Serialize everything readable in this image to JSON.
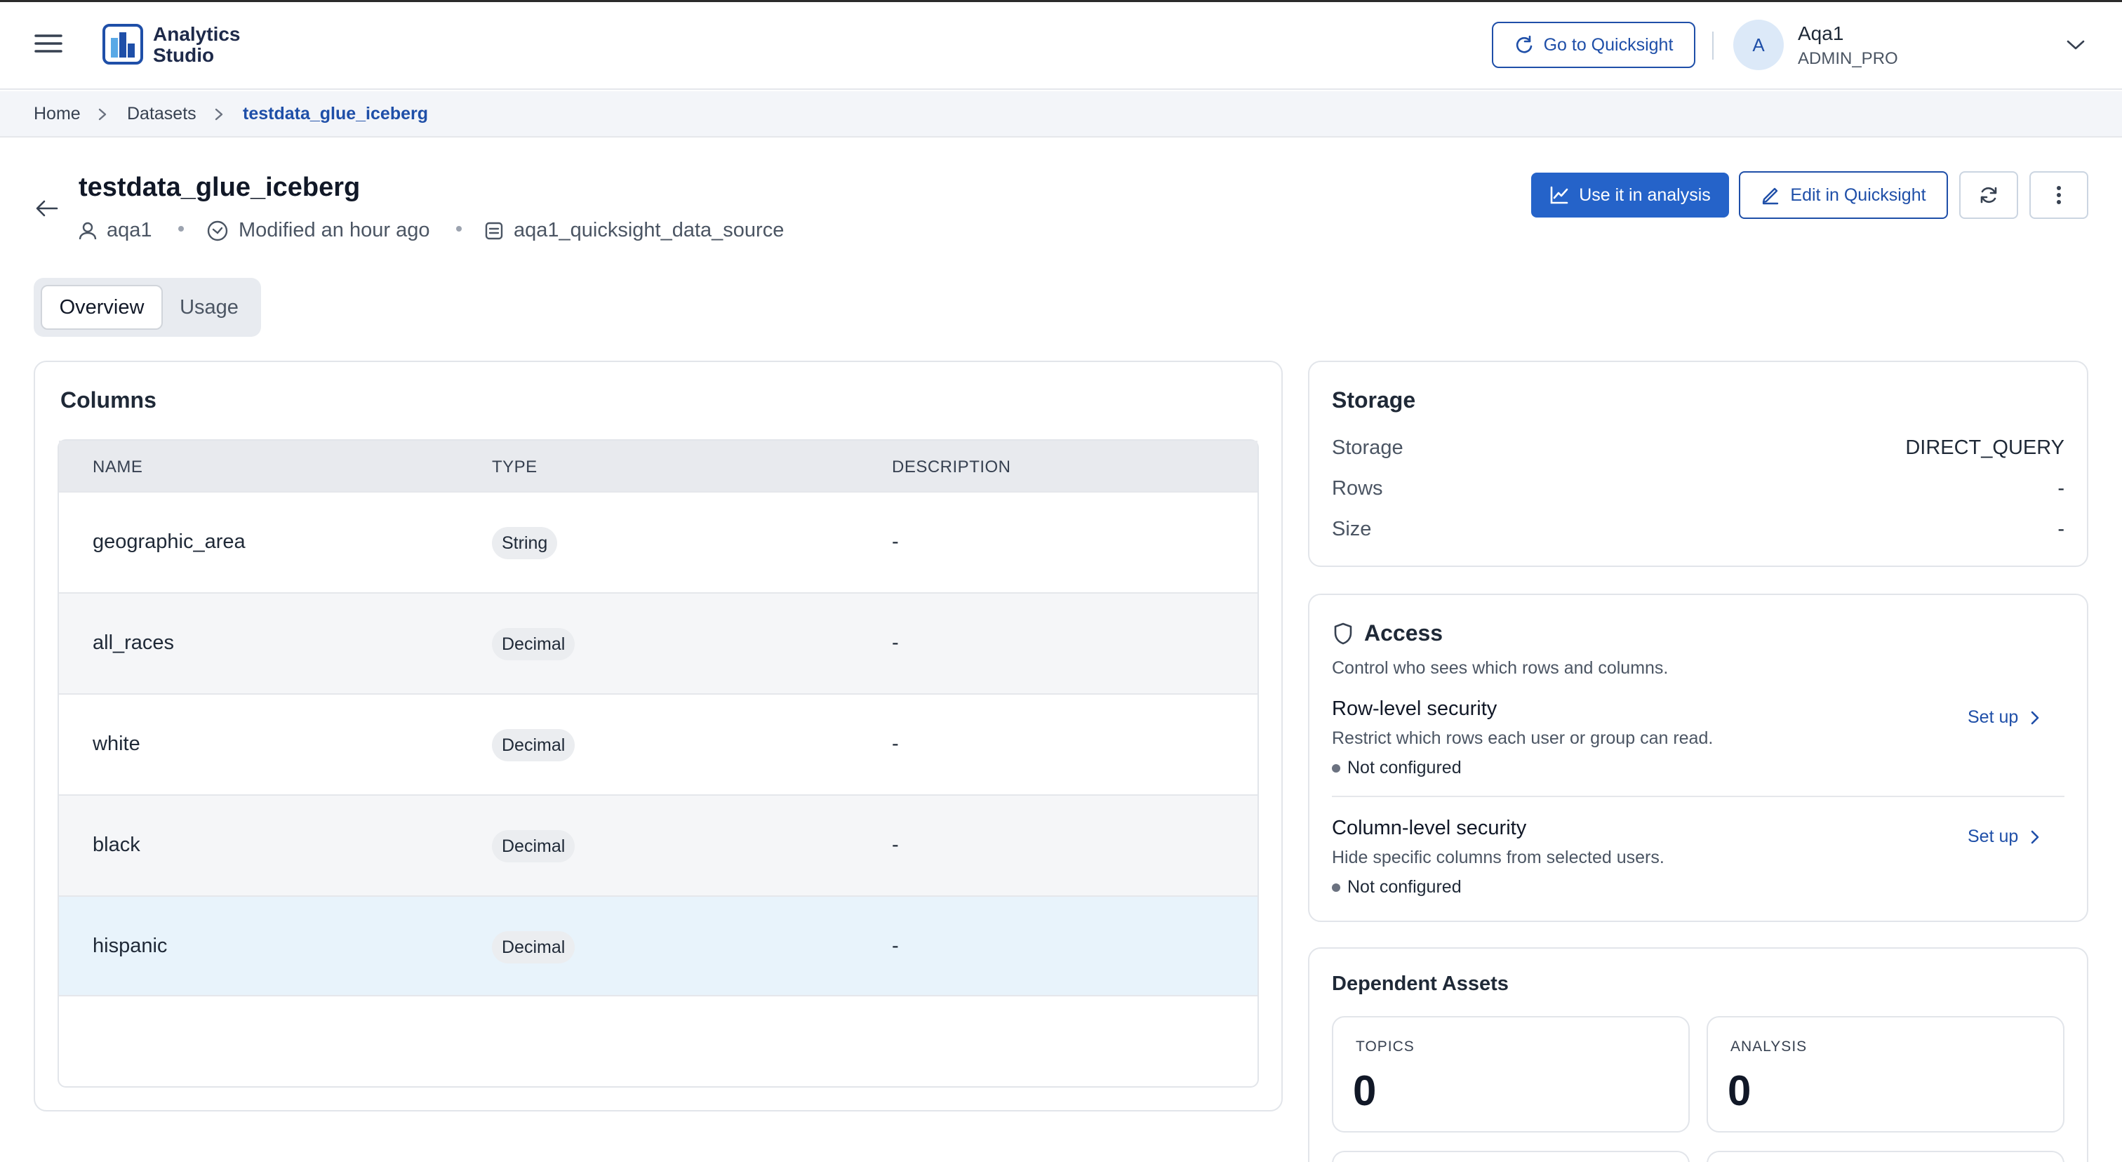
{
  "header": {
    "logo_line1": "Analytics",
    "logo_line2": "Studio",
    "quicksight_button": "Go to Quicksight",
    "user_initial": "A",
    "user_name": "Aqa1",
    "user_role": "ADMIN_PRO"
  },
  "breadcrumb": {
    "items": [
      "Home",
      "Datasets",
      "testdata_glue_iceberg"
    ]
  },
  "dataset": {
    "title": "testdata_glue_iceberg",
    "owner": "aqa1",
    "modified": "Modified an hour ago",
    "data_source": "aqa1_quicksight_data_source"
  },
  "actions": {
    "use_in_analysis": "Use it in analysis",
    "edit_in_quicksight": "Edit in Quicksight"
  },
  "tabs": [
    "Overview",
    "Usage"
  ],
  "columns_card": {
    "title": "Columns",
    "headers": [
      "NAME",
      "TYPE",
      "DESCRIPTION"
    ],
    "rows": [
      {
        "name": "geographic_area",
        "type": "String",
        "description": "-"
      },
      {
        "name": "all_races",
        "type": "Decimal",
        "description": "-"
      },
      {
        "name": "white",
        "type": "Decimal",
        "description": "-"
      },
      {
        "name": "black",
        "type": "Decimal",
        "description": "-"
      },
      {
        "name": "hispanic",
        "type": "Decimal",
        "description": "-"
      }
    ]
  },
  "storage": {
    "title": "Storage",
    "items": [
      {
        "label": "Storage",
        "value": "DIRECT_QUERY"
      },
      {
        "label": "Rows",
        "value": "-"
      },
      {
        "label": "Size",
        "value": "-"
      }
    ]
  },
  "access": {
    "title": "Access",
    "subtitle": "Control who sees which rows and columns.",
    "row_level": {
      "title": "Row-level security",
      "description": "Restrict which rows each user or group can read.",
      "status": "Not configured",
      "action": "Set up"
    },
    "column_level": {
      "title": "Column-level security",
      "description": "Hide specific columns from selected users.",
      "status": "Not configured",
      "action": "Set up"
    }
  },
  "dependent_assets": {
    "title": "Dependent Assets",
    "topics_label": "TOPICS",
    "topics_value": "0",
    "analysis_label": "ANALYSIS",
    "analysis_value": "0"
  },
  "colors": {
    "accent": "#2563c9",
    "accent_dark": "#1f4fa8",
    "highlight_row": "#e8f3fb",
    "alt_row": "#f5f6f8"
  }
}
